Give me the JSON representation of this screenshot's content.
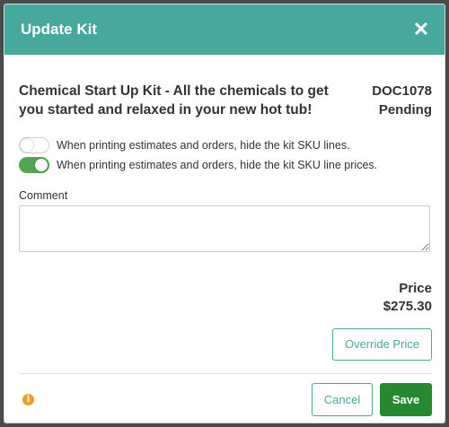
{
  "modal": {
    "title": "Update Kit",
    "close_symbol": "✕"
  },
  "kit": {
    "name": "Chemical Start Up Kit - All the chemicals to get you started and relaxed in your new hot tub!",
    "doc_number": "DOC1078",
    "status": "Pending"
  },
  "options": [
    {
      "label": "When printing estimates and orders, hide the kit SKU lines.",
      "enabled": false
    },
    {
      "label": "When printing estimates and orders, hide the kit SKU line prices.",
      "enabled": true
    }
  ],
  "comment": {
    "label": "Comment",
    "value": ""
  },
  "price": {
    "label": "Price",
    "value": "$275.30"
  },
  "buttons": {
    "override_price": "Override Price",
    "cancel": "Cancel",
    "save": "Save"
  },
  "colors": {
    "header": "#47a99b",
    "toggle_on": "#4fa84f",
    "save": "#258a2e",
    "info": "#f0a020"
  },
  "icons": {
    "close": "close-icon",
    "info": "info-icon"
  }
}
